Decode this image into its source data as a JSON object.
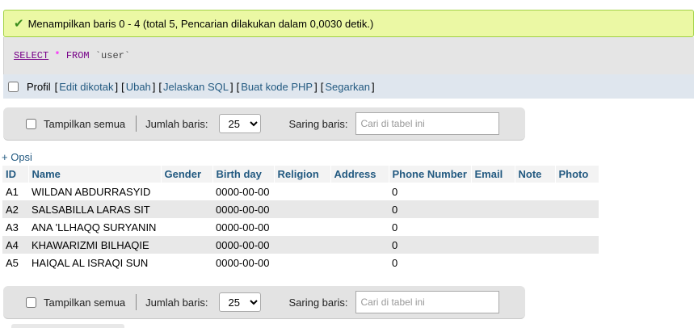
{
  "message": {
    "icon": "checkmark-icon",
    "text": "Menampilkan baris 0 - 4 (total 5, Pencarian dilakukan dalam 0,0030 detik.)"
  },
  "query": {
    "select": "SELECT",
    "star": "*",
    "from": "FROM",
    "table": "`user`"
  },
  "profil_bar": {
    "label": "Profil",
    "links": [
      "Edit dikotak",
      "Ubah",
      "Jelaskan SQL",
      "Buat kode PHP",
      "Segarkan"
    ]
  },
  "nav": {
    "show_all_label": "Tampilkan semua",
    "rows_label": "Jumlah baris:",
    "rows_value": "25",
    "filter_label": "Saring baris:",
    "filter_placeholder": "Cari di tabel ini"
  },
  "options_link": "+ Opsi",
  "table": {
    "columns": [
      "ID",
      "Name",
      "Gender",
      "Birth day",
      "Religion",
      "Address",
      "Phone Number",
      "Email",
      "Note",
      "Photo"
    ],
    "rows": [
      [
        "A1",
        "WILDAN ABDURRASYID",
        "",
        "0000-00-00",
        "",
        "",
        "0",
        "",
        "",
        ""
      ],
      [
        "A2",
        "SALSABILLA LARAS SIT",
        "",
        "0000-00-00",
        "",
        "",
        "0",
        "",
        "",
        ""
      ],
      [
        "A3",
        "ANA 'LLHAQQ SURYANIN",
        "",
        "0000-00-00",
        "",
        "",
        "0",
        "",
        "",
        ""
      ],
      [
        "A4",
        "KHAWARIZMI BILHAQIE",
        "",
        "0000-00-00",
        "",
        "",
        "0",
        "",
        "",
        ""
      ],
      [
        "A5",
        "HAIQAL AL ISRAQI SUN",
        "",
        "0000-00-00",
        "",
        "",
        "0",
        "",
        "",
        ""
      ]
    ]
  }
}
